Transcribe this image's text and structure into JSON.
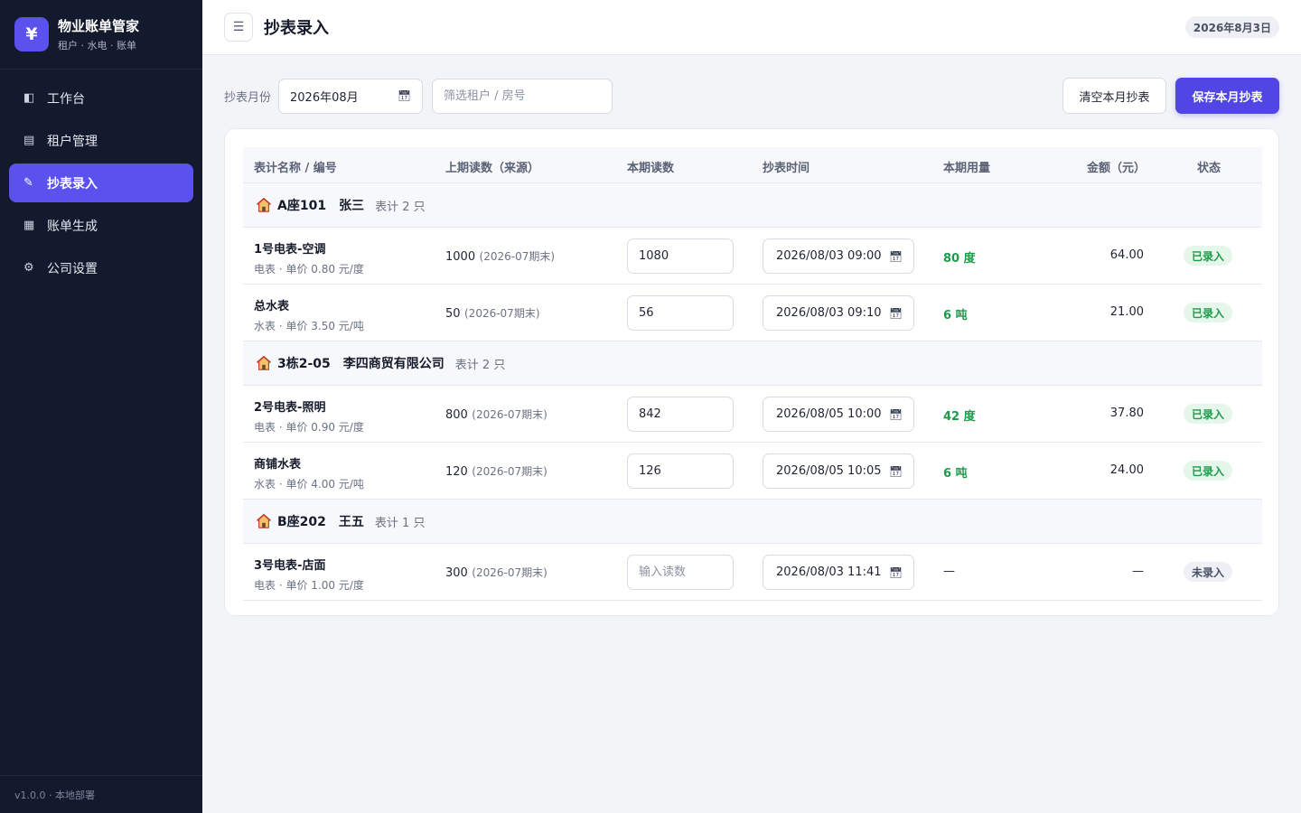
{
  "app": {
    "logo_glyph": "¥",
    "title": "物业账单管家",
    "subtitle": "租户 · 水电 · 账单"
  },
  "sidebar": {
    "items": [
      {
        "label": "工作台",
        "icon": "dashboard-icon",
        "glyph": "◧",
        "active": false
      },
      {
        "label": "租户管理",
        "icon": "list-icon",
        "glyph": "▤",
        "active": false
      },
      {
        "label": "抄表录入",
        "icon": "pencil-icon",
        "glyph": "✎",
        "active": true
      },
      {
        "label": "账单生成",
        "icon": "grid-icon",
        "glyph": "▦",
        "active": false
      },
      {
        "label": "公司设置",
        "icon": "gear-icon",
        "glyph": "⚙",
        "active": false
      }
    ],
    "footer": "v1.0.0 · 本地部署"
  },
  "header": {
    "menu_glyph": "☰",
    "title": "抄表录入",
    "date": "2026年8月3日"
  },
  "toolbar": {
    "month_label": "抄表月份",
    "month_value": "2026年08月",
    "filter_placeholder": "筛选租户 / 房号",
    "clear_label": "清空本月抄表",
    "save_label": "保存本月抄表"
  },
  "table": {
    "headers": {
      "meter": "表计名称 / 编号",
      "prev": "上期读数（来源）",
      "current": "本期读数",
      "time": "抄表时间",
      "usage": "本期用量",
      "amount": "金额（元）",
      "status": "状态"
    },
    "groups": [
      {
        "room": "A座101",
        "tenant": "张三",
        "count": "表计 2 只",
        "rows": [
          {
            "name": "1号电表-空调",
            "desc": "电表 · 单价 0.80 元/度",
            "prev": "1000",
            "prev_src": "(2026-07期末)",
            "current": "1080",
            "time": "2026/08/03  09:00",
            "usage": "80 度",
            "amount": "64.00",
            "status": "已录入",
            "done": true
          },
          {
            "name": "总水表",
            "desc": "水表 · 单价 3.50 元/吨",
            "prev": "50",
            "prev_src": "(2026-07期末)",
            "current": "56",
            "time": "2026/08/03  09:10",
            "usage": "6 吨",
            "amount": "21.00",
            "status": "已录入",
            "done": true
          }
        ]
      },
      {
        "room": "3栋2-05",
        "tenant": "李四商贸有限公司",
        "count": "表计 2 只",
        "rows": [
          {
            "name": "2号电表-照明",
            "desc": "电表 · 单价 0.90 元/度",
            "prev": "800",
            "prev_src": "(2026-07期末)",
            "current": "842",
            "time": "2026/08/05  10:00",
            "usage": "42 度",
            "amount": "37.80",
            "status": "已录入",
            "done": true
          },
          {
            "name": "商铺水表",
            "desc": "水表 · 单价 4.00 元/吨",
            "prev": "120",
            "prev_src": "(2026-07期末)",
            "current": "126",
            "time": "2026/08/05  10:05",
            "usage": "6 吨",
            "amount": "24.00",
            "status": "已录入",
            "done": true
          }
        ]
      },
      {
        "room": "B座202",
        "tenant": "王五",
        "count": "表计 1 只",
        "rows": [
          {
            "name": "3号电表-店面",
            "desc": "电表 · 单价 1.00 元/度",
            "prev": "300",
            "prev_src": "(2026-07期末)",
            "current": "",
            "current_placeholder": "输入读数",
            "time": "2026/08/03  11:41",
            "usage": "—",
            "amount": "—",
            "status": "未录入",
            "done": false
          }
        ]
      }
    ]
  },
  "colors": {
    "accent": "#5b52ee",
    "sidebar_bg": "#141a2e",
    "success": "#1d9a4a"
  }
}
